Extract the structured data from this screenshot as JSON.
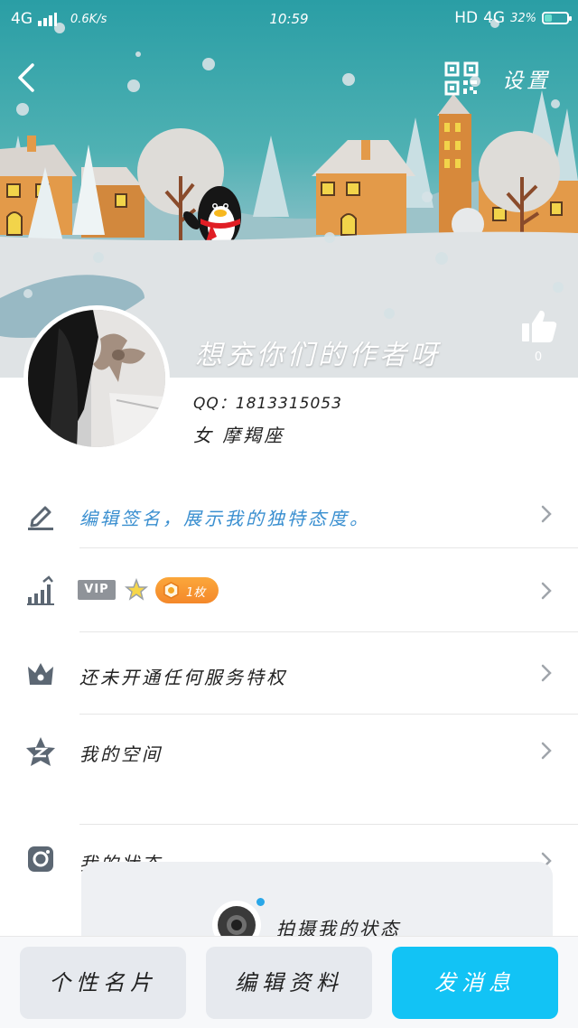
{
  "status_bar": {
    "network_left": "4G",
    "speed": "0.6K/s",
    "time": "10:59",
    "network_right_hd": "HD",
    "network_right": "4G",
    "battery_pct": "32%",
    "battery_level": 0.32
  },
  "header": {
    "back_icon": "chevron-left-icon",
    "qr_icon": "qr-code-icon",
    "settings_label": "设置",
    "nickname": "想充你们的作者呀",
    "like_icon": "thumbs-up-icon",
    "like_count": "0"
  },
  "profile": {
    "qq_line": "QQ：1813315053",
    "gender_zodiac": "女  摩羯座"
  },
  "rows": {
    "signature": {
      "icon": "pencil-icon",
      "label": "编辑签名，展示我的独特态度。",
      "color": "#3a8fd0"
    },
    "level": {
      "icon": "level-chart-icon",
      "vip_label": "VIP",
      "star_icon": "star-icon",
      "medal_icon": "medal-icon",
      "medal_label": "1枚"
    },
    "privilege": {
      "icon": "crown-icon",
      "label": "还未开通任何服务特权"
    },
    "space": {
      "icon": "qzone-icon",
      "label": "我的空间"
    },
    "status": {
      "icon": "instagram-camera-icon",
      "label": "我的状态",
      "capture_label": "拍摄我的状态"
    }
  },
  "bottom_bar": {
    "card_button": "个性名片",
    "edit_button": "编辑资料",
    "message_button": "发消息"
  },
  "colors": {
    "accent_blue": "#12c3f5",
    "medal_orange": "#f4882a",
    "banner_teal": "#2a9ea5"
  }
}
